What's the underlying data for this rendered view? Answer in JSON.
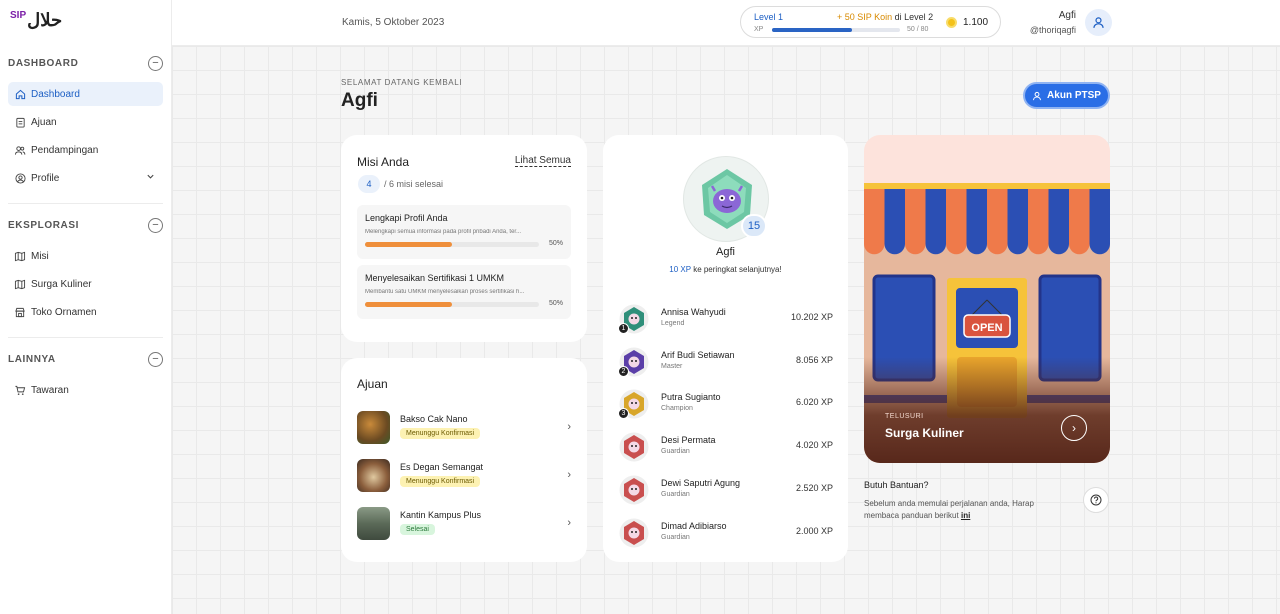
{
  "brand": {
    "logo_small": "SIP",
    "logo_main": "حلال"
  },
  "sidebar": {
    "sections": [
      {
        "title": "DASHBOARD",
        "items": [
          {
            "label": "Dashboard",
            "icon": "home-icon",
            "active": true
          },
          {
            "label": "Ajuan",
            "icon": "clipboard-icon"
          },
          {
            "label": "Pendampingan",
            "icon": "users-icon"
          },
          {
            "label": "Profile",
            "icon": "user-circle-icon",
            "expandable": true
          }
        ]
      },
      {
        "title": "EKSPLORASI",
        "items": [
          {
            "label": "Misi",
            "icon": "map-icon"
          },
          {
            "label": "Surga Kuliner",
            "icon": "map-fold-icon"
          },
          {
            "label": "Toko Ornamen",
            "icon": "store-icon"
          }
        ]
      },
      {
        "title": "LAINNYA",
        "items": [
          {
            "label": "Tawaran",
            "icon": "cart-icon"
          }
        ]
      }
    ]
  },
  "header": {
    "date": "Kamis, 5 Oktober 2023",
    "level": {
      "current": "Level 1",
      "bonus_prefix": "+ 50 SIP Koin",
      "bonus_suffix": "di Level 2",
      "xp_label": "XP",
      "xp_text": "50 / 80",
      "progress": 0.625
    },
    "coins": "1.100",
    "user": {
      "name": "Agfi",
      "handle": "@thoriqagfi"
    }
  },
  "welcome": {
    "subtitle": "SELAMAT DATANG KEMBALI",
    "title": "Agfi",
    "akun_button": "Akun PTSP"
  },
  "missions": {
    "title": "Misi Anda",
    "see_all": "Lihat Semua",
    "count": "4",
    "count_text": "/ 6 misi selesai",
    "items": [
      {
        "title": "Lengkapi Profil Anda",
        "desc": "Melengkapi semua informasi pada profil pribadi Anda, ter...",
        "percent": "50%",
        "value": 0.5
      },
      {
        "title": "Menyelesaikan Sertifikasi 1 UMKM",
        "desc": "Membantu satu UMKM menyelesaikan proses sertifikasi h...",
        "percent": "50%",
        "value": 0.5
      }
    ]
  },
  "ajuan": {
    "title": "Ajuan",
    "items": [
      {
        "name": "Bakso Cak Nano",
        "status": "Menunggu Konfirmasi",
        "state": "wait"
      },
      {
        "name": "Es Degan Semangat",
        "status": "Menunggu Konfirmasi",
        "state": "wait"
      },
      {
        "name": "Kantin Kampus Plus",
        "status": "Selesai",
        "state": "done"
      }
    ]
  },
  "ranking": {
    "level": "15",
    "name": "Agfi",
    "next_xp": "10 XP",
    "next_text": "ke peringkat selanjutnya!",
    "leaders": [
      {
        "name": "Annisa Wahyudi",
        "tier": "Legend",
        "xp": "10.202 XP",
        "pos": "1",
        "color": "#2f8f7a"
      },
      {
        "name": "Arif Budi Setiawan",
        "tier": "Master",
        "xp": "8.056 XP",
        "pos": "2",
        "color": "#5b3fa8"
      },
      {
        "name": "Putra Sugianto",
        "tier": "Champion",
        "xp": "6.020 XP",
        "pos": "3",
        "color": "#d8a62a"
      },
      {
        "name": "Desi Permata",
        "tier": "Guardian",
        "xp": "4.020 XP",
        "pos": "",
        "color": "#c94f4f"
      },
      {
        "name": "Dewi Saputri Agung",
        "tier": "Guardian",
        "xp": "2.520 XP",
        "pos": "",
        "color": "#c94f4f"
      },
      {
        "name": "Dimad Adibiarso",
        "tier": "Guardian",
        "xp": "2.000 XP",
        "pos": "",
        "color": "#c94f4f"
      }
    ]
  },
  "explore": {
    "kicker": "TELUSURI",
    "title": "Surga Kuliner",
    "sign": "OPEN"
  },
  "help": {
    "title": "Butuh Bantuan?",
    "text": "Sebelum anda memulai perjalanan anda, Harap membaca panduan berikut",
    "link": "ini"
  }
}
